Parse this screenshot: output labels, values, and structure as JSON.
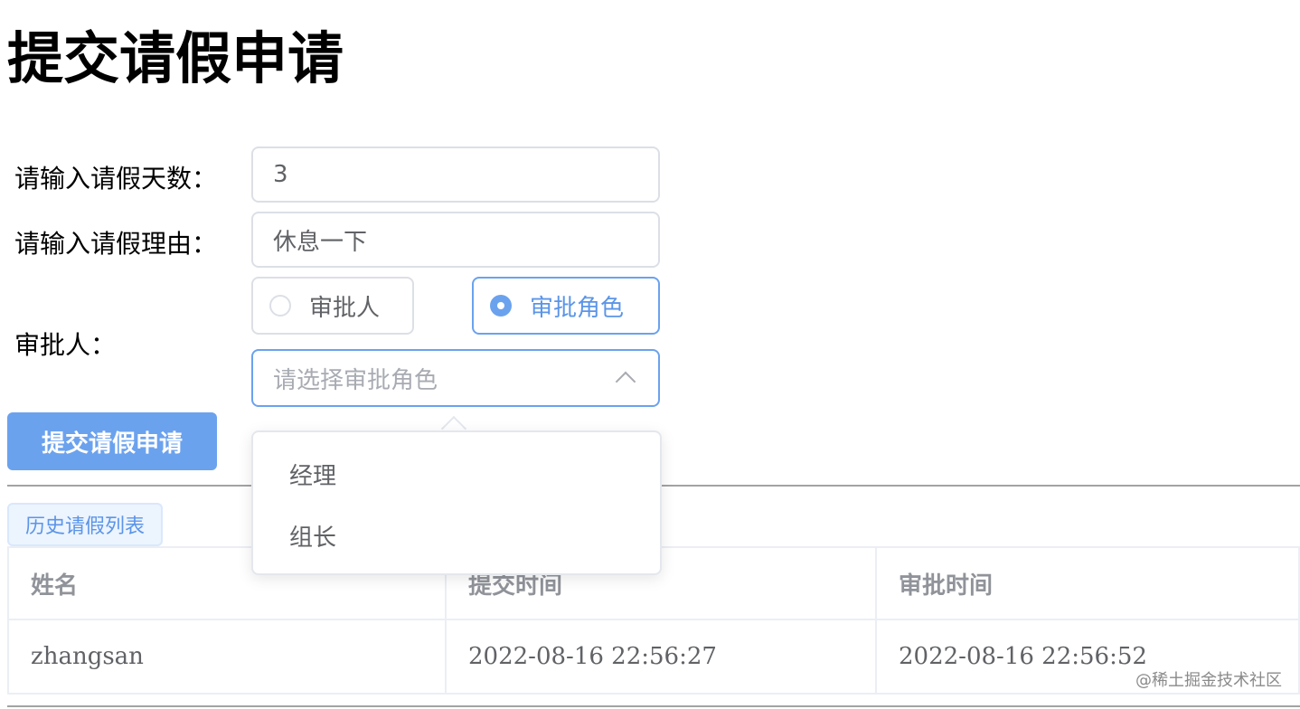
{
  "page": {
    "title": "提交请假申请"
  },
  "form": {
    "days_label": "请输入请假天数：",
    "days_value": "3",
    "reason_label": "请输入请假理由：",
    "reason_value": "休息一下",
    "approver_label": "审批人：",
    "radio_options": [
      {
        "label": "审批人",
        "checked": false
      },
      {
        "label": "审批角色",
        "checked": true
      }
    ],
    "role_select_placeholder": "请选择审批角色",
    "submit_label": "提交请假申请"
  },
  "dropdown": {
    "options": [
      "经理",
      "组长"
    ]
  },
  "history": {
    "tag_label": "历史请假列表",
    "columns": [
      "姓名",
      "提交时间",
      "审批时间"
    ],
    "rows": [
      [
        "zhangsan",
        "2022-08-16 22:56:27",
        "2022-08-16 22:56:52"
      ]
    ]
  },
  "watermark": "@稀土掘金技术社区",
  "colors": {
    "primary": "#6ba2ee",
    "primary_text": "#5b95e8",
    "border": "#dcdfe6",
    "text": "#606266",
    "placeholder": "#a8abb2",
    "header_text": "#909399"
  }
}
